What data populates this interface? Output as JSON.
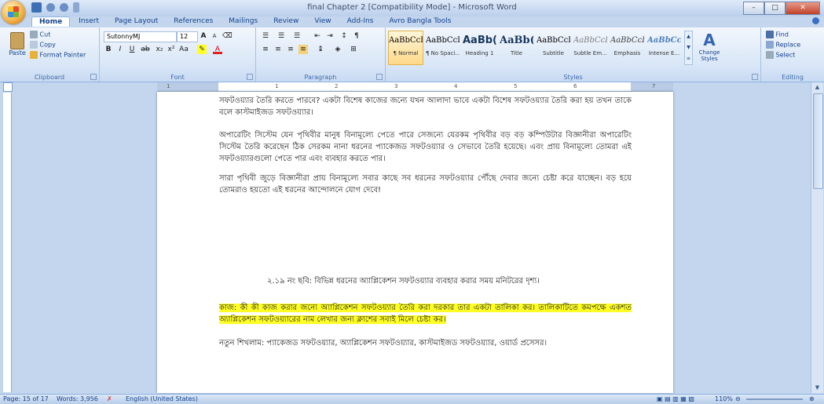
{
  "window": {
    "title": "final Chapter 2 [Compatibility Mode] - Microsoft Word",
    "tabs": [
      "Home",
      "Insert",
      "Page Layout",
      "References",
      "Mailings",
      "Review",
      "View",
      "Add-Ins",
      "Avro Bangla Tools"
    ]
  },
  "ribbon": {
    "clipboard": {
      "paste": "Paste",
      "cut": "Cut",
      "copy": "Copy",
      "format_painter": "Format Painter",
      "label": "Clipboard"
    },
    "font": {
      "name": "SutonnyMJ",
      "size": "12",
      "label": "Font"
    },
    "paragraph": {
      "label": "Paragraph"
    },
    "styles": {
      "label": "Styles",
      "items": [
        {
          "sample": "AaBbCcI",
          "name": "¶ Normal"
        },
        {
          "sample": "AaBbCcI",
          "name": "¶ No Spaci..."
        },
        {
          "sample": "AaBb(",
          "name": "Heading 1"
        },
        {
          "sample": "AaBb(",
          "name": "Title"
        },
        {
          "sample": "AaBbCcI",
          "name": "Subtitle"
        },
        {
          "sample": "AaBbCcI",
          "name": "Subtle Em..."
        },
        {
          "sample": "AaBbCcI",
          "name": "Emphasis"
        },
        {
          "sample": "AaBbCc",
          "name": "Intense E..."
        }
      ],
      "change_styles": "Change Styles"
    },
    "editing": {
      "find": "Find",
      "replace": "Replace",
      "select": "Select",
      "label": "Editing"
    }
  },
  "document": {
    "para1": "সফটওয়্যার তৈরি করতে পারবে? একটা বিশেষ কাজের জন্যে যখন আলাদা ভাবে একটা বিশেষ সফটওয়্যার তৈরি করা হয় তখন তাকে বলে কাস্টমাইজড সফটওয়্যার।",
    "para2": "অপারেটিং সিস্টেম যেন পৃথিবীর মানুষ বিনামূল্যে পেতে পারে সেজন্যে যেরকম পৃথিবীর বড় বড় কম্পিউটার বিজ্ঞানীরা অপারেটিং সিস্টেম তৈরি করেছেন ঠিক সেরকম নানা ধরনের প্যাকেজড সফটওয়্যার ও সেভাবে তৈরি হয়েছে। এবং প্রায় বিনামূল্যে তোমরা এই সফটওয়্যারগুলো পেতে পার এবং ব্যবহার করতে পার।",
    "para3": "সারা পৃথিবী জুড়ে বিজ্ঞানীরা প্রায় বিনামূল্যে সবার কাছে সব ধরনের সফটওয়্যার পৌঁছে দেবার জন্যে চেষ্টা করে যাচ্ছেন। বড় হয়ে তোমরাও হয়তো এই ধরনের আন্দোলনে যোগ দেবে!",
    "caption": "২.১৯ নং ছবি: বিভিন্ন ধরনের অ্যাপ্লিকেশন সফটওয়্যার ব্যবহার করার সময় মনিটরের দৃশ্য।",
    "task": "কাজ: কী কী কাজ করার জন্যে অ্যাপ্লিকেশন সফটওয়্যার তৈরি করা দরকার তার একটা তালিকা কর। তালিকাটিতে কমপক্ষে একশত অ্যাপ্লিকেশন সফটওয়্যারের নাম লেখার জন্য ক্লাশের সবাই মিলে চেষ্টা কর।",
    "new_words": "নতুন শিখলাম: প্যাকেজড সফটওয়্যার, অ্যাপ্লিকেশন সফটওয়্যার, কাস্টমাইজড সফটওয়্যার, ওয়ার্ড প্রসেসর।"
  },
  "ruler_numbers": [
    "1",
    "1",
    "2",
    "3",
    "4",
    "5",
    "6",
    "7"
  ],
  "status": {
    "page": "Page: 15 of 17",
    "words": "Words: 3,956",
    "language": "English (United States)",
    "zoom": "110%"
  }
}
